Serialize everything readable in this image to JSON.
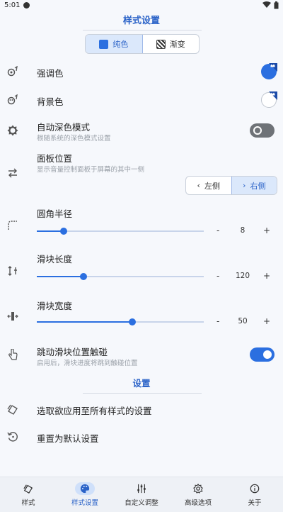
{
  "status_bar": {
    "time": "5:01"
  },
  "header": {
    "title": "样式设置"
  },
  "segmented": {
    "solid_label": "纯色",
    "gradient_label": "渐变",
    "selected": "solid"
  },
  "rows": {
    "accent": {
      "title": "强调色"
    },
    "background": {
      "title": "背景色"
    },
    "auto_dark": {
      "title": "自动深色模式",
      "subtitle": "根随系统的深色模式设置",
      "enabled": false
    },
    "panel_position": {
      "title": "面板位置",
      "subtitle": "显示音量控制面板于屏幕的其中一侧",
      "left_label": "左侧",
      "right_label": "右侧",
      "selected": "right"
    },
    "corner_radius": {
      "title": "圆角半径",
      "value": "8",
      "level": 0.16
    },
    "slider_length": {
      "title": "滑块长度",
      "value": "120",
      "level": 0.28
    },
    "slider_width": {
      "title": "滑块宽度",
      "value": "50",
      "level": 0.57
    },
    "jump_touch": {
      "title": "跳动滑块位置触碰",
      "subtitle": "启用后，滑块进度将跳到触碰位置",
      "enabled": true
    }
  },
  "stepper": {
    "minus": "-",
    "plus": "+"
  },
  "settings_section": {
    "title": "设置",
    "apply_all": "选取欲应用至所有样式的设置",
    "reset": "重置为默认设置"
  },
  "bottom_nav": {
    "items": [
      {
        "label": "样式",
        "icon": "styles-icon"
      },
      {
        "label": "样式设置",
        "icon": "palette-icon"
      },
      {
        "label": "自定义调整",
        "icon": "tune-icon"
      },
      {
        "label": "高级选项",
        "icon": "gear-icon"
      },
      {
        "label": "关于",
        "icon": "info-icon"
      }
    ],
    "active_index": 1
  },
  "colors": {
    "accent": "#2b6fe0",
    "navy": "#1a4aa8"
  }
}
